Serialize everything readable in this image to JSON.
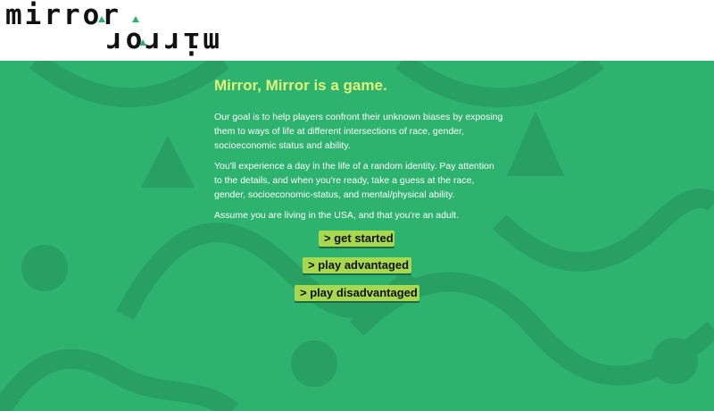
{
  "logo": {
    "top_text": "mirror",
    "bottom_text": "mirror"
  },
  "intro": {
    "headline": "Mirror, Mirror is a game.",
    "paragraph_1": "Our goal is to help players confront their unknown biases by exposing them to ways of life at different intersections of race, gender, socioeconomic status and ability.",
    "paragraph_2": "You'll experience a day in the life of a random identity. Pay attention to the details, and when you're ready, take a guess at the race, gender, socioeconomic-status, and mental/physical ability.",
    "paragraph_3": "Assume you are living in the USA, and that you're an adult."
  },
  "actions": {
    "get_started": "> get started",
    "play_advantaged": "> play advantaged",
    "play_disadvantaged": "> play disadvantaged"
  },
  "colors": {
    "background_green": "#2db36d",
    "pattern_green": "#27a062",
    "headline_yellow": "#dff27a",
    "button_green": "#a8d84f",
    "logo_black": "#111111"
  }
}
